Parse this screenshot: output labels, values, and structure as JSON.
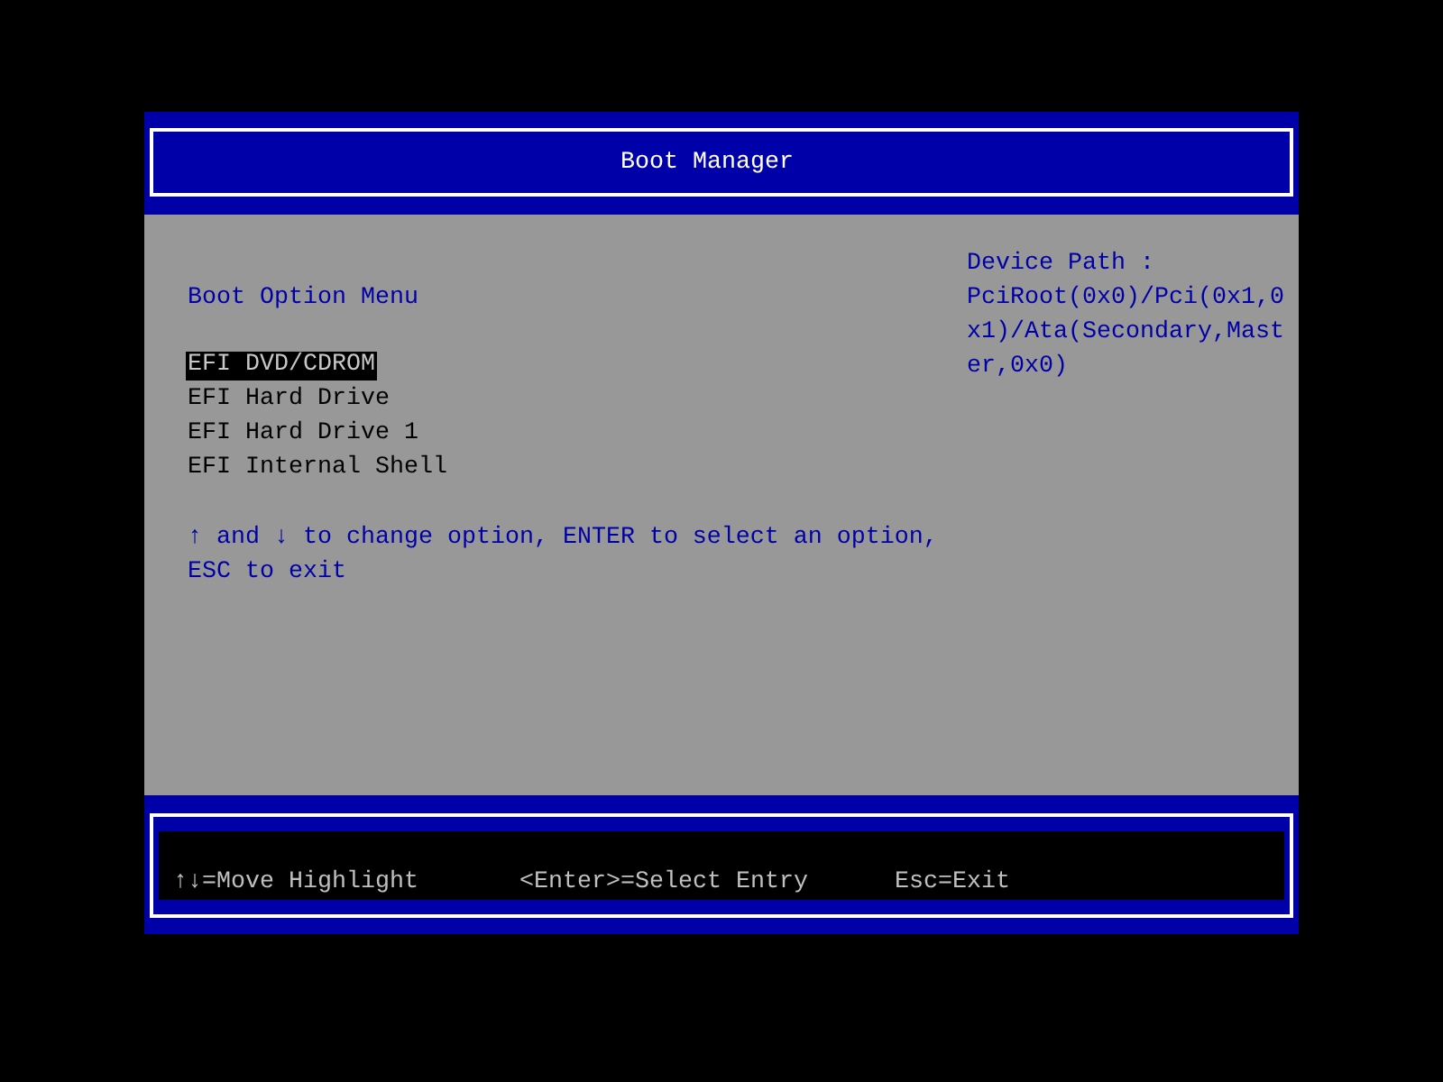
{
  "header": {
    "title": "Boot Manager"
  },
  "menu": {
    "title": "Boot Option Menu",
    "options": [
      {
        "label": "EFI DVD/CDROM",
        "selected": true
      },
      {
        "label": "EFI Hard Drive",
        "selected": false
      },
      {
        "label": "EFI Hard Drive 1",
        "selected": false
      },
      {
        "label": "EFI Internal Shell",
        "selected": false
      }
    ],
    "help": "↑ and ↓ to change option, ENTER to select an option, ESC to exit"
  },
  "device_path": {
    "label": "Device Path :",
    "value": "PciRoot(0x0)/Pci(0x1,0x1)/Ata(Secondary,Master,0x0)"
  },
  "footer": {
    "hints": [
      "↑↓=Move Highlight",
      "<Enter>=Select Entry",
      "Esc=Exit"
    ]
  }
}
